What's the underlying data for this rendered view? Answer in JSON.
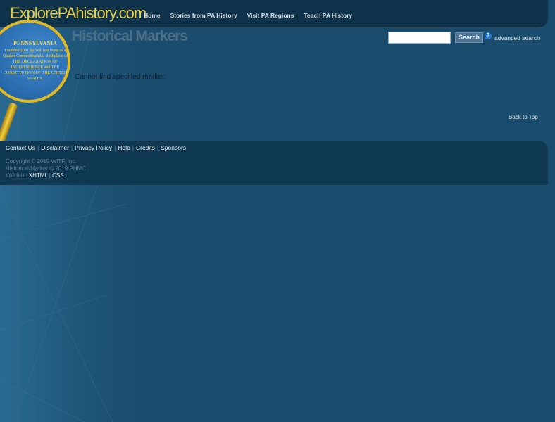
{
  "header": {
    "logo": "ExplorePAhistory.com",
    "nav": [
      "Home",
      "Stories from PA History",
      "Visit PA Regions",
      "Teach PA History"
    ]
  },
  "marker_sign": {
    "title": "PENNSYLVANIA",
    "text": "Founded 1681 by William Penn as a Quaker Commonwealth. Birthplace of THE DECLARATION OF INDEPENDENCE and THE CONSTITUTION OF THE UNITED STATES."
  },
  "page": {
    "title": "Historical Markers",
    "message": "Cannot find specified marker.",
    "back_to_top": "Back to Top"
  },
  "search": {
    "value": "",
    "button": "Search",
    "help": "?",
    "advanced": "advanced search"
  },
  "footer": {
    "links": [
      "Contact Us",
      "Disclaimer",
      "Privacy Policy",
      "Help",
      "Credits",
      "Sponsors"
    ],
    "copyright": "Copyright © 2019 WITF, Inc.",
    "marker_copyright": "Historical Marker © 2019 PHMC",
    "validate_label": "Validate:",
    "validate_links": [
      "XHTML",
      "CSS"
    ]
  }
}
